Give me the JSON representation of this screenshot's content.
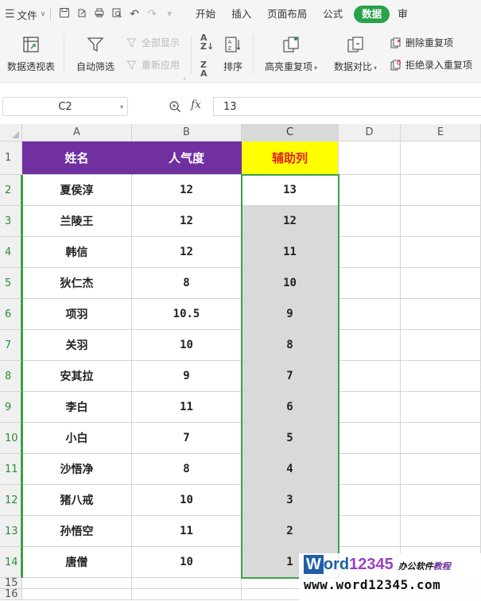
{
  "menubar": {
    "file_label": "文件",
    "tabs": [
      {
        "label": "开始",
        "active": false
      },
      {
        "label": "插入",
        "active": false
      },
      {
        "label": "页面布局",
        "active": false
      },
      {
        "label": "公式",
        "active": false
      },
      {
        "label": "数据",
        "active": true
      },
      {
        "label": "审",
        "active": false
      }
    ],
    "accent_color": "#2aa24a"
  },
  "ribbon": {
    "pivot_table": "数据透视表",
    "auto_filter": "自动筛选",
    "show_all": "全部显示",
    "reapply": "重新应用",
    "sort": "排序",
    "highlight_duplicates": "高亮重复项",
    "data_compare": "数据对比",
    "remove_duplicates": "删除重复项",
    "reject_duplicates": "拒绝录入重复项"
  },
  "formula_bar": {
    "name_box": "C2",
    "fx_label": "fx",
    "value": "13"
  },
  "sheet": {
    "columns": [
      "A",
      "B",
      "C",
      "D",
      "E"
    ],
    "selected_column": "C",
    "rows": [
      "1",
      "2",
      "3",
      "4",
      "5",
      "6",
      "7",
      "8",
      "9",
      "10",
      "11",
      "12",
      "13",
      "14",
      "15",
      "16"
    ],
    "headers": [
      "姓名",
      "人气度",
      "辅助列"
    ],
    "data": [
      [
        "夏侯淳",
        "12",
        "13"
      ],
      [
        "兰陵王",
        "12",
        "12"
      ],
      [
        "韩信",
        "12",
        "11"
      ],
      [
        "狄仁杰",
        "8",
        "10"
      ],
      [
        "项羽",
        "10.5",
        "9"
      ],
      [
        "关羽",
        "10",
        "8"
      ],
      [
        "安其拉",
        "9",
        "7"
      ],
      [
        "李白",
        "11",
        "6"
      ],
      [
        "小白",
        "7",
        "5"
      ],
      [
        "沙悟净",
        "8",
        "4"
      ],
      [
        "猪八戒",
        "10",
        "3"
      ],
      [
        "孙悟空",
        "11",
        "2"
      ],
      [
        "唐僧",
        "10",
        "1"
      ]
    ],
    "header_color": "#7030a0",
    "aux_header_bg": "#ffff00",
    "aux_header_text": "#e02020",
    "selection_color": "#3aa04a"
  },
  "watermark": {
    "w": "W",
    "ord": "ord",
    "num": "12345",
    "office": "办公软件教程",
    "url": "www.word12345.com"
  }
}
